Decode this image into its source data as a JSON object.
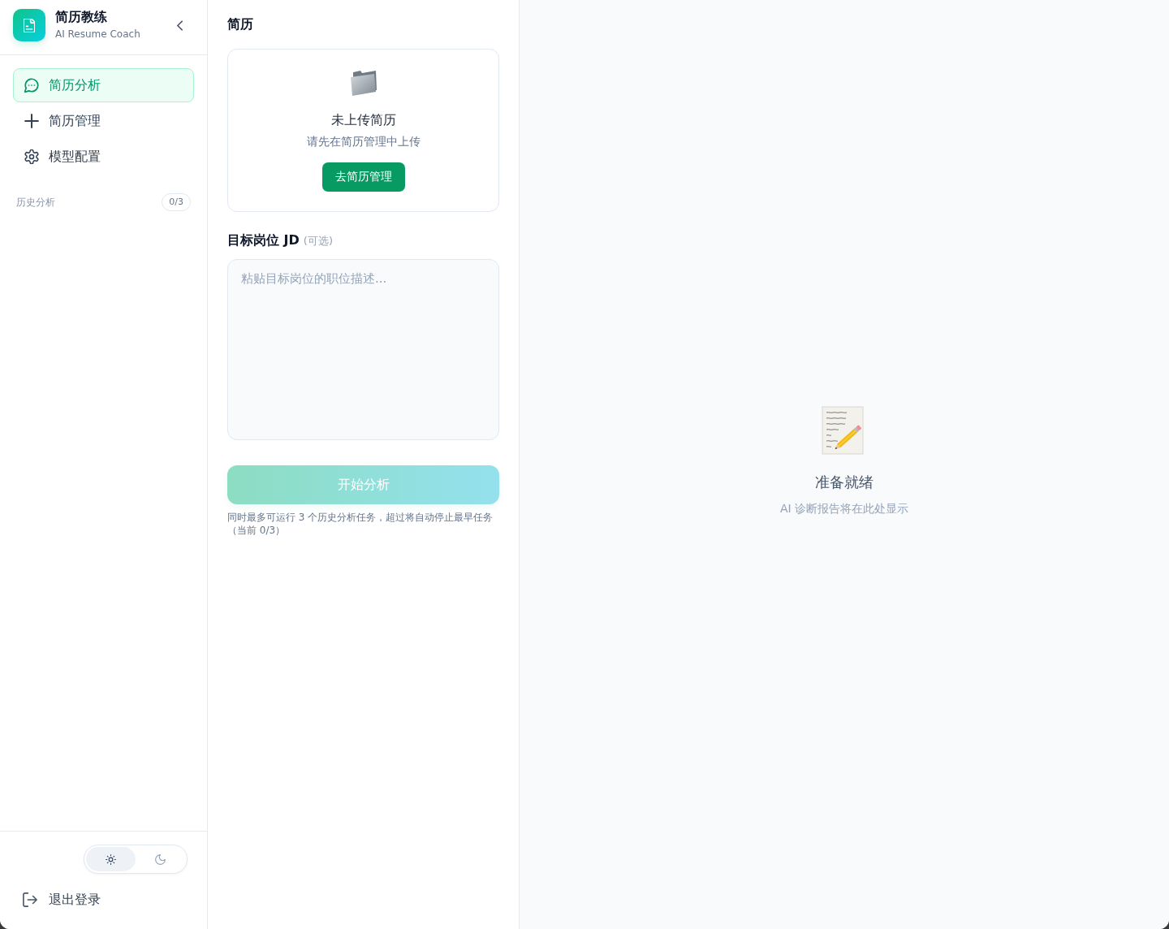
{
  "sidebar": {
    "app_title": "简历教练",
    "app_subtitle": "AI Resume Coach",
    "nav_items": [
      {
        "label": "简历分析",
        "selected": true
      },
      {
        "label": "简历管理",
        "selected": false
      },
      {
        "label": "模型配置",
        "selected": false
      }
    ],
    "history": {
      "label": "历史分析",
      "count": "0/3"
    },
    "theme_toggle": {
      "options": [
        {
          "selected": true
        },
        {
          "selected": false
        }
      ]
    },
    "logout": "退出登录"
  },
  "resume_panel": {
    "title": "简历",
    "empty_state": {
      "title": "未上传简历",
      "hint": "请先在简历管理中上传",
      "button": "去简历管理"
    },
    "jd": {
      "label": "目标岗位 JD",
      "optional": "(可选)",
      "placeholder": "粘贴目标岗位的职位描述..."
    },
    "start_button": {
      "label": "开始分析",
      "disabled": true
    },
    "note": "同时最多可运行 3 个历史分析任务，超过将自动停止最早任务（当前 0/3）"
  },
  "report_panel": {
    "title": "准备就绪",
    "subtitle": "AI 诊断报告将在此处显示"
  }
}
